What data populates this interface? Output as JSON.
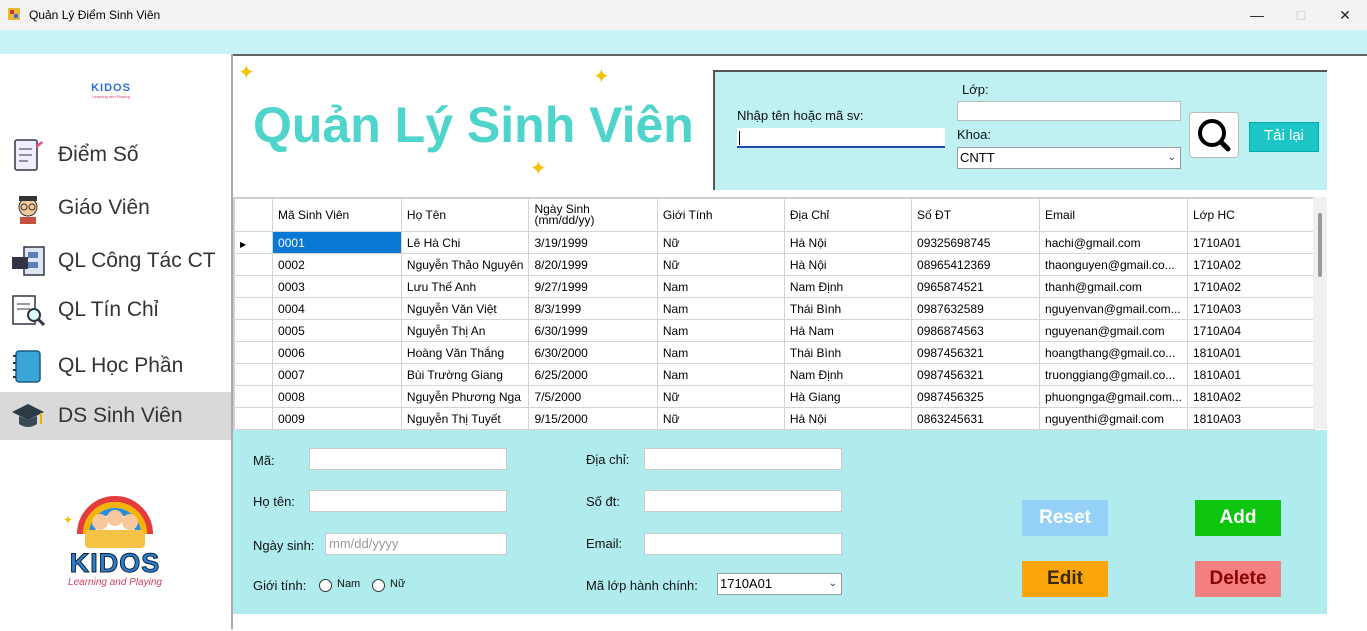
{
  "window": {
    "title": "Quản Lý Điểm Sinh Viên"
  },
  "sidebar": {
    "logo_text": "KIDOS",
    "logo_sub": "Learning and Playing",
    "items": [
      {
        "label": "Điểm Số",
        "icon": "grades-icon"
      },
      {
        "label": "Giáo Viên",
        "icon": "teacher-icon"
      },
      {
        "label": "QL Công Tác CT",
        "icon": "work-icon"
      },
      {
        "label": "QL Tín Chỉ",
        "icon": "credit-search-icon"
      },
      {
        "label": "QL Học Phần",
        "icon": "notebook-icon"
      },
      {
        "label": "DS Sinh Viên",
        "icon": "graduation-cap-icon"
      }
    ],
    "active_index": 5,
    "bottom_logo_text": "KIDOS",
    "bottom_logo_sub": "Learning and Playing"
  },
  "header": {
    "title": "Quản Lý Sinh Viên"
  },
  "search": {
    "name_label": "Nhập tên hoặc mã sv:",
    "name_value": "",
    "class_label": "Lớp:",
    "class_value": "",
    "faculty_label": "Khoa:",
    "faculty_value": "CNTT",
    "reload_label": "Tải lại"
  },
  "table": {
    "columns": [
      "Mã Sinh Viên",
      "Họ Tên",
      "Ngày Sinh (mm/dd/yy)",
      "Giới Tính",
      "Địa Chỉ",
      "Số ĐT",
      "Email",
      "Lớp HC"
    ],
    "date_col_line1": "Ngày Sinh",
    "date_col_line2": "(mm/dd/yy)",
    "rows": [
      [
        "0001",
        "Lê Hà Chi",
        "3/19/1999",
        "Nữ",
        "Hà Nội",
        "09325698745",
        "hachi@gmail.com",
        "1710A01"
      ],
      [
        "0002",
        "Nguyễn Thảo Nguyên",
        "8/20/1999",
        "Nữ",
        "Hà Nội",
        "08965412369",
        "thaonguyen@gmail.co...",
        "1710A02"
      ],
      [
        "0003",
        "Lưu Thế Anh",
        "9/27/1999",
        "Nam",
        "Nam Định",
        "0965874521",
        "thanh@gmail.com",
        "1710A02"
      ],
      [
        "0004",
        "Nguyễn Văn Việt",
        "8/3/1999",
        "Nam",
        "Thái Bình",
        "0987632589",
        "nguyenvan@gmail.com...",
        "1710A03"
      ],
      [
        "0005",
        "Nguyễn Thị An",
        "6/30/1999",
        "Nam",
        "Hà Nam",
        "0986874563",
        "nguyenan@gmail.com",
        "1710A04"
      ],
      [
        "0006",
        "Hoàng Văn Thắng",
        "6/30/2000",
        "Nam",
        "Thái Bình",
        "0987456321",
        "hoangthang@gmail.co...",
        "1810A01"
      ],
      [
        "0007",
        "Bùi Trường Giang",
        "6/25/2000",
        "Nam",
        "Nam Định",
        "0987456321",
        "truonggiang@gmail.co...",
        "1810A01"
      ],
      [
        "0008",
        "Nguyễn Phương Nga",
        "7/5/2000",
        "Nữ",
        "Hà Giang",
        "0987456325",
        "phuongnga@gmail.com...",
        "1810A02"
      ],
      [
        "0009",
        "Nguyễn Thị Tuyết",
        "9/15/2000",
        "Nữ",
        "Hà Nội",
        "0863245631",
        "nguyenthi@gmail.com",
        "1810A03"
      ]
    ]
  },
  "form": {
    "ma_label": "Mã:",
    "hoten_label": "Họ tên:",
    "ngaysinh_label": "Ngày sinh:",
    "ngaysinh_placeholder": "mm/dd/yyyy",
    "gioitinh_label": "Giới tính:",
    "nam_label": "Nam",
    "nu_label": "Nữ",
    "diachi_label": "Địa chỉ:",
    "sodt_label": "Số đt:",
    "email_label": "Email:",
    "malop_label": "Mã lớp hành chính:",
    "malop_value": "1710A01"
  },
  "buttons": {
    "reset": "Reset",
    "add": "Add",
    "edit": "Edit",
    "delete": "Delete"
  },
  "colors": {
    "accent": "#4fd4cc",
    "form_bg": "#b0eced",
    "reset": "#94d0f7",
    "add": "#0ec50e",
    "edit": "#fba40c",
    "delete": "#f48080"
  }
}
